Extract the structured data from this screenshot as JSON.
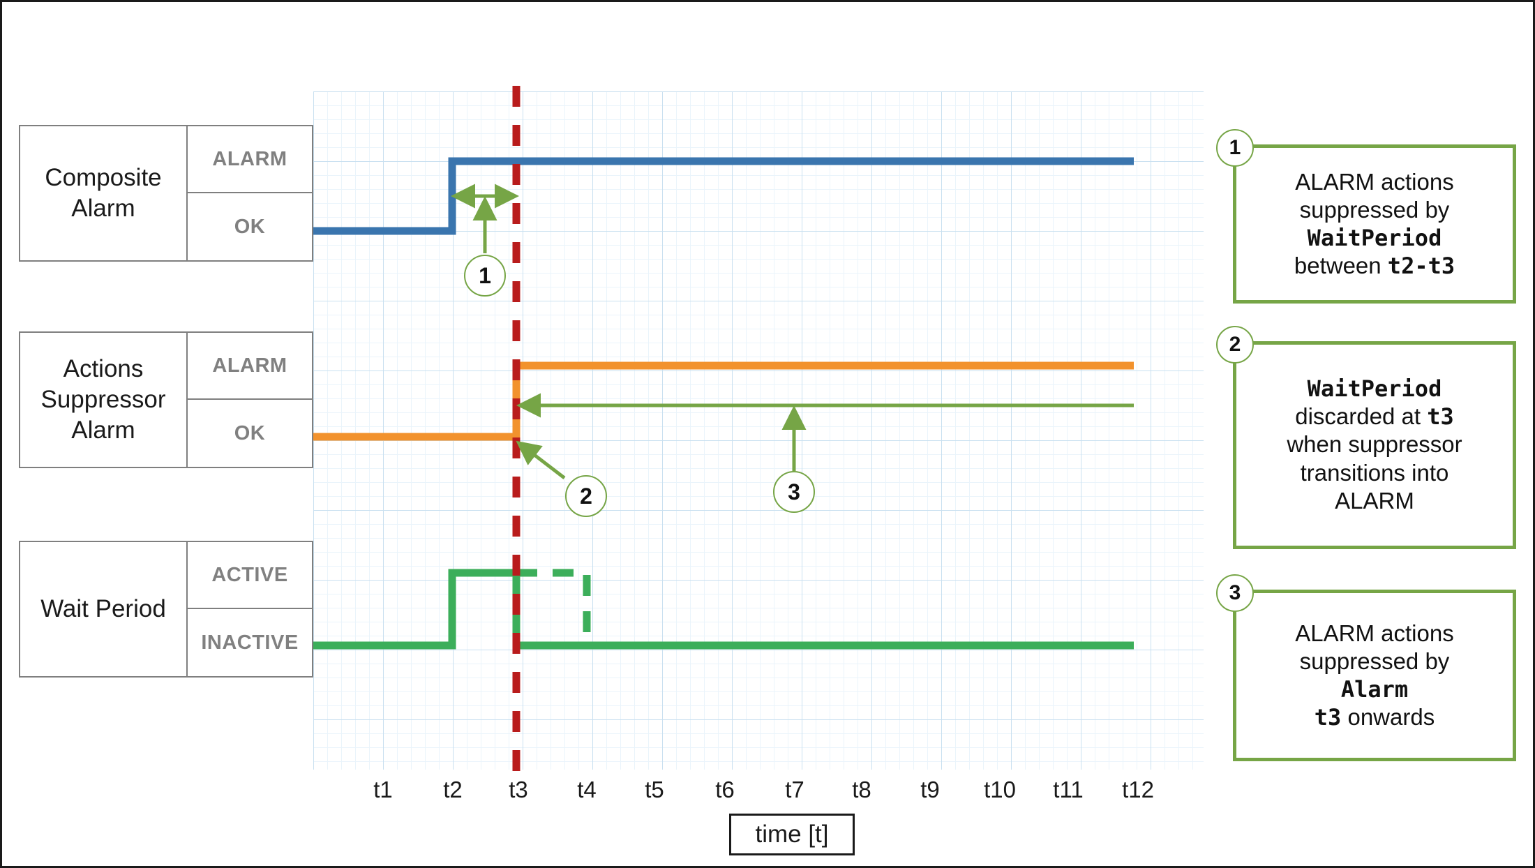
{
  "diagram": {
    "axis_title": "time [t]",
    "tick_labels": [
      "t1",
      "t2",
      "t3",
      "t4",
      "t5",
      "t6",
      "t7",
      "t8",
      "t9",
      "t10",
      "t11",
      "t12"
    ],
    "colors": {
      "composite_alarm": "#3a75ae",
      "actions_suppressor": "#f2922d",
      "wait_period": "#3cae5a",
      "now_marker": "#b91c1c",
      "annotation": "#76a546",
      "grid_major": "#c9e0f0",
      "grid_minor": "#eaf4fb",
      "table_border": "#7f7f7f",
      "level_text": "#808080"
    }
  },
  "tracks": [
    {
      "name": "Composite Alarm",
      "levels": {
        "upper": "ALARM",
        "lower": "OK"
      }
    },
    {
      "name": "Actions Suppressor Alarm",
      "levels": {
        "upper": "ALARM",
        "lower": "OK"
      }
    },
    {
      "name": "Wait Period",
      "levels": {
        "upper": "ACTIVE",
        "lower": "INACTIVE"
      }
    }
  ],
  "markers": [
    {
      "id": "1",
      "label": "1"
    },
    {
      "id": "2",
      "label": "2"
    },
    {
      "id": "3",
      "label": "3"
    }
  ],
  "callouts": [
    {
      "badge": "1",
      "lines": [
        {
          "text": "ALARM actions",
          "mono": false
        },
        {
          "text": "suppressed by",
          "mono": false
        },
        {
          "text": "WaitPeriod",
          "mono": true
        },
        {
          "text": "between t2-t3",
          "mono": false,
          "mono_tail": "t2-t3",
          "plain_head": "between "
        }
      ]
    },
    {
      "badge": "2",
      "lines": [
        {
          "text": "WaitPeriod",
          "mono": true
        },
        {
          "text": "discarded at t3",
          "mono": false,
          "plain_head": "discarded at ",
          "mono_tail": "t3"
        },
        {
          "text": "when suppressor",
          "mono": false
        },
        {
          "text": "transitions into",
          "mono": false
        },
        {
          "text": "ALARM",
          "mono": false
        }
      ]
    },
    {
      "badge": "3",
      "lines": [
        {
          "text": "ALARM actions",
          "mono": false
        },
        {
          "text": "suppressed by",
          "mono": false
        },
        {
          "text": "Alarm",
          "mono": true
        },
        {
          "text": "t3 onwards",
          "mono": false,
          "mono_head": "t3",
          "plain_tail": " onwards"
        }
      ]
    }
  ],
  "chart_data": {
    "type": "line",
    "title": "",
    "xlabel": "time [t]",
    "ylabel": "",
    "x_ticks": [
      "t1",
      "t2",
      "t3",
      "t4",
      "t5",
      "t6",
      "t7",
      "t8",
      "t9",
      "t10",
      "t11",
      "t12"
    ],
    "grid": true,
    "legend": "left-row-labels",
    "now_marker": {
      "at": "t3",
      "style": "dashed",
      "color": "#b91c1c"
    },
    "series": [
      {
        "name": "Composite Alarm",
        "color": "#3a75ae",
        "states": [
          "OK",
          "ALARM"
        ],
        "steps": [
          {
            "from": "t0",
            "to": "t2",
            "value": "OK"
          },
          {
            "from": "t2",
            "to": "t12",
            "value": "ALARM"
          }
        ]
      },
      {
        "name": "Actions Suppressor Alarm",
        "color": "#f2922d",
        "states": [
          "OK",
          "ALARM"
        ],
        "steps": [
          {
            "from": "t0",
            "to": "t3",
            "value": "OK"
          },
          {
            "from": "t3",
            "to": "t12",
            "value": "ALARM"
          }
        ]
      },
      {
        "name": "Wait Period",
        "color": "#3cae5a",
        "states": [
          "INACTIVE",
          "ACTIVE"
        ],
        "steps": [
          {
            "from": "t0",
            "to": "t2",
            "value": "INACTIVE"
          },
          {
            "from": "t2",
            "to": "t3",
            "value": "ACTIVE"
          },
          {
            "from": "t3",
            "to": "t12",
            "value": "INACTIVE"
          }
        ],
        "dashed_projection": {
          "from": "t3",
          "to": "t4",
          "value": "ACTIVE",
          "note": "would-have-been ACTIVE, discarded"
        }
      }
    ],
    "annotations": [
      {
        "id": "1",
        "type": "double-arrow",
        "span": "t2-t3",
        "on": "Composite Alarm"
      },
      {
        "id": "2",
        "type": "arrow",
        "target": "t3",
        "on": "Actions Suppressor Alarm"
      },
      {
        "id": "3",
        "type": "arrow",
        "target": "t3-onwards",
        "on": "Actions Suppressor Alarm"
      }
    ]
  }
}
